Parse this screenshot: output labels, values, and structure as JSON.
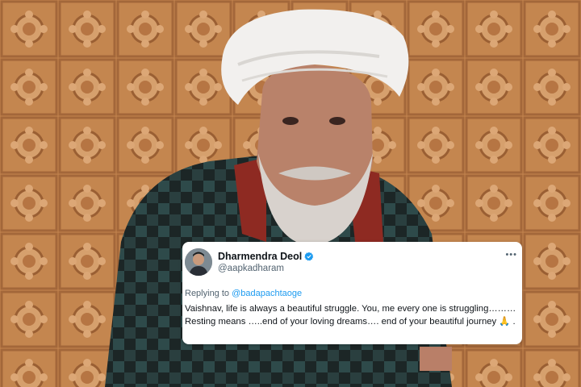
{
  "tweet": {
    "display_name": "Dharmendra Deol",
    "handle": "@aapkadharam",
    "reply_prefix": "Replying to ",
    "reply_to": "@badapachtaoge",
    "text": "Vaishnav, life is always a beautiful struggle. You, me every one is struggling………Resting means …..end of your loving dreams…. end of your beautiful journey 🙏 .",
    "more_icon": "more-horizontal-icon",
    "verified_icon": "verified-badge-icon"
  },
  "colors": {
    "accent": "#1d9bf0",
    "text": "#0f1419",
    "secondary": "#536471",
    "wall": "#c98a54"
  }
}
